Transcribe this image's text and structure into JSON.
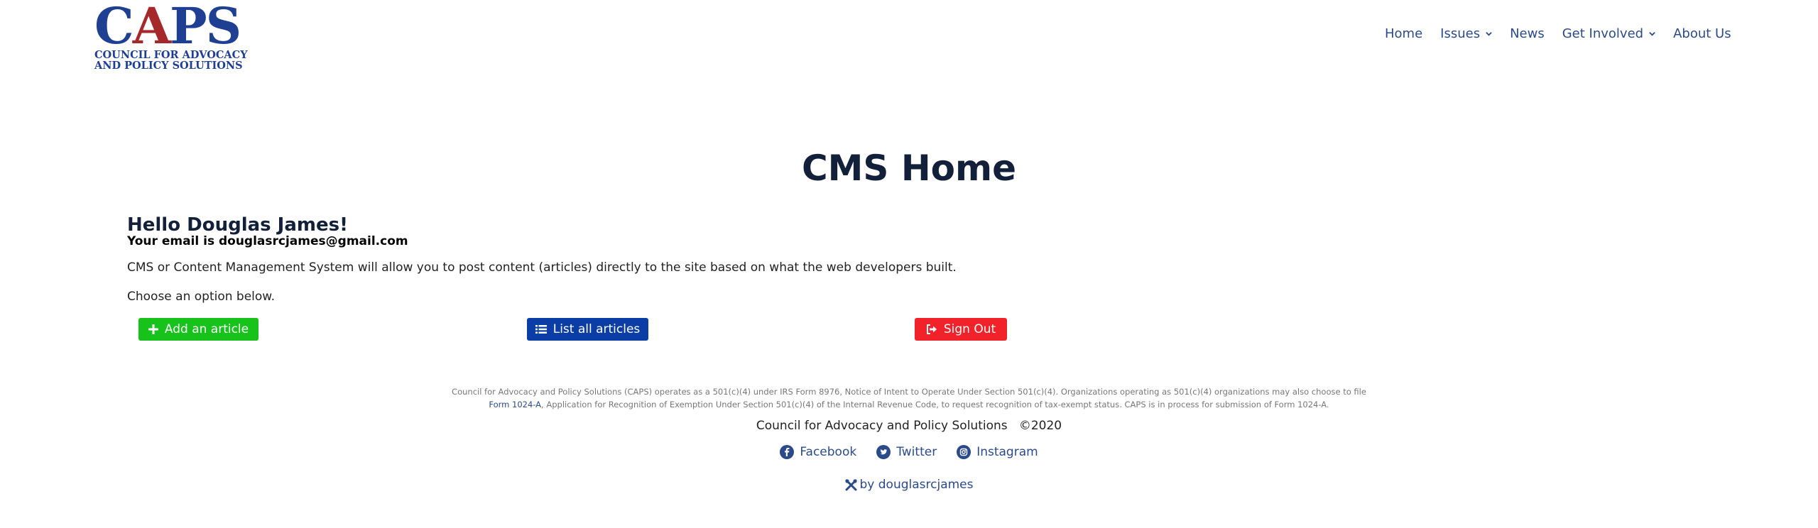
{
  "logo": {
    "letters_c": "C",
    "letters_a": "A",
    "letters_ps": "PS",
    "line1": "COUNCIL FOR ADVOCACY",
    "line2": "AND POLICY SOLUTIONS"
  },
  "nav": {
    "home": "Home",
    "issues": "Issues",
    "news": "News",
    "get_involved": "Get Involved",
    "about": "About Us"
  },
  "main": {
    "title": "CMS Home",
    "greeting": "Hello Douglas James!",
    "email_line": "Your email is douglasrcjames@gmail.com",
    "description": "CMS or Content Management System will allow you to post content (articles) directly to the site based on what the web developers built.",
    "choose": "Choose an option below."
  },
  "buttons": {
    "add": "Add an article",
    "list": "List all articles",
    "signout": "Sign Out"
  },
  "footer": {
    "disclaimer_part1": "Council for Advocacy and Policy Solutions (CAPS) operates as a 501(c)(4) under IRS Form 8976, Notice of Intent to Operate Under Section 501(c)(4). Organizations operating as 501(c)(4) organizations may also choose to file ",
    "disclaimer_link": "Form 1024-A",
    "disclaimer_part2": ", Application for Recognition of Exemption Under Section 501(c)(4) of the Internal Revenue Code, to request recognition of tax-exempt status. CAPS is in process for submission of Form 1024-A.",
    "org": "Council for Advocacy and Policy Solutions",
    "year": "©2020",
    "facebook": "Facebook",
    "twitter": "Twitter",
    "instagram": "Instagram",
    "credit": "by douglasrcjames"
  },
  "colors": {
    "brand_blue": "#1f3f93",
    "brand_red": "#a5292a",
    "add_green": "#17c21b",
    "list_blue": "#0a3ea6",
    "signout_red": "#f2222b"
  },
  "icons": [
    "plus-icon",
    "list-icon",
    "sign-out-icon",
    "chevron-down-icon",
    "facebook-icon",
    "twitter-icon",
    "instagram-icon",
    "tools-icon"
  ]
}
